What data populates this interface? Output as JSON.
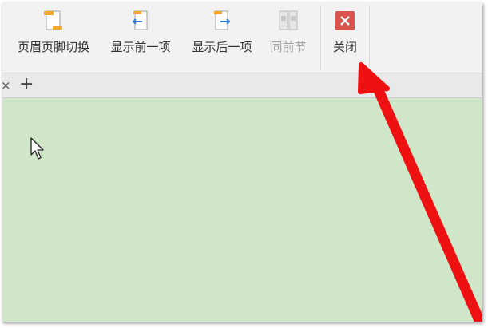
{
  "toolbar": {
    "items": [
      {
        "label": "页眉页脚切换",
        "icon": "header-footer-switch-icon",
        "enabled": true
      },
      {
        "label": "显示前一项",
        "icon": "show-previous-icon",
        "enabled": true
      },
      {
        "label": "显示后一项",
        "icon": "show-next-icon",
        "enabled": true
      },
      {
        "label": "同前节",
        "icon": "same-as-previous-icon",
        "enabled": false
      },
      {
        "label": "关闭",
        "icon": "close-icon",
        "enabled": true
      }
    ]
  },
  "tabs": {
    "close_glyph": "×",
    "add_glyph": "+"
  },
  "colors": {
    "document_background": "#d0e6c9",
    "toolbar_background": "#f2f2f2",
    "close_icon": "#d9534f",
    "annotation_arrow": "#ee1111"
  }
}
